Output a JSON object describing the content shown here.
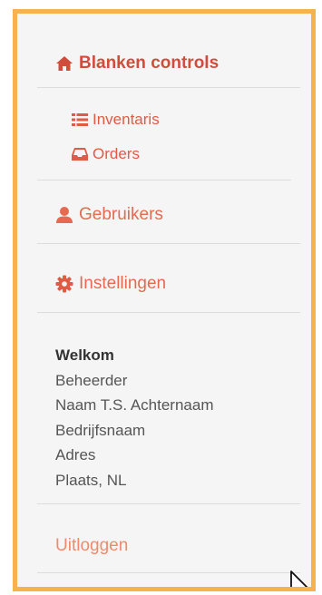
{
  "menu": {
    "title": "Blanken controls",
    "title_icon": "home-icon",
    "submenu": [
      {
        "label": "Inventaris",
        "icon": "list-icon"
      },
      {
        "label": "Orders",
        "icon": "inbox-icon"
      }
    ],
    "main_items": [
      {
        "label": "Gebruikers",
        "icon": "user-icon"
      },
      {
        "label": "Instellingen",
        "icon": "gear-icon"
      }
    ]
  },
  "welcome": {
    "heading": "Welkom",
    "lines": [
      "Beheerder",
      "Naam T.S. Achternaam",
      "Bedrijfsnaam",
      "Adres",
      "Plaats, NL"
    ]
  },
  "logout": {
    "label": "Uitloggen"
  },
  "colors": {
    "frame_border": "#f5b24e",
    "accent": "#e05b45",
    "title": "#d14d3b",
    "logout": "#ef8a6e",
    "background": "#f5f5f5"
  }
}
